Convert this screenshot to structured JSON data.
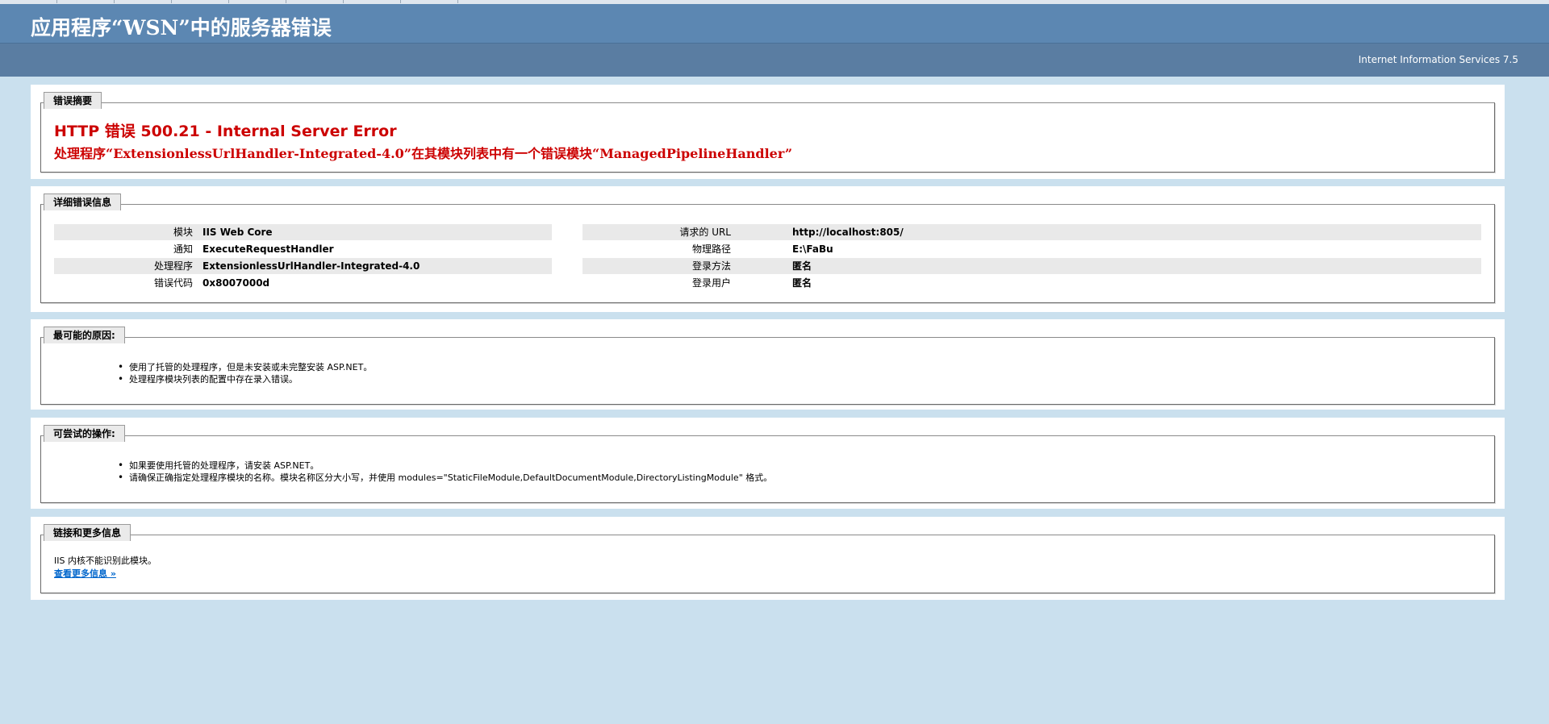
{
  "page": {
    "title": "应用程序“WSN”中的服务器错误",
    "server": "Internet Information Services 7.5"
  },
  "summary": {
    "legend": "错误摘要",
    "heading": "HTTP 错误 500.21 - Internal Server Error",
    "description": "处理程序“ExtensionlessUrlHandler-Integrated-4.0”在其模块列表中有一个错误模块“ManagedPipelineHandler”"
  },
  "details": {
    "legend": "详细错误信息",
    "left": [
      {
        "label": "模块",
        "value": "IIS Web Core"
      },
      {
        "label": "通知",
        "value": "ExecuteRequestHandler"
      },
      {
        "label": "处理程序",
        "value": "ExtensionlessUrlHandler-Integrated-4.0"
      },
      {
        "label": "错误代码",
        "value": "0x8007000d"
      }
    ],
    "right": [
      {
        "label": "请求的 URL",
        "value": "http://localhost:805/"
      },
      {
        "label": "物理路径",
        "value": "E:\\FaBu"
      },
      {
        "label": "登录方法",
        "value": "匿名"
      },
      {
        "label": "登录用户",
        "value": "匿名"
      }
    ]
  },
  "causes": {
    "legend": "最可能的原因:",
    "items": [
      "使用了托管的处理程序，但是未安装或未完整安装 ASP.NET。",
      "处理程序模块列表的配置中存在录入错误。"
    ]
  },
  "actions": {
    "legend": "可尝试的操作:",
    "items": [
      "如果要使用托管的处理程序，请安装 ASP.NET。",
      "请确保正确指定处理程序模块的名称。模块名称区分大小写，并使用 modules=\"StaticFileModule,DefaultDocumentModule,DirectoryListingModule\" 格式。"
    ]
  },
  "links": {
    "legend": "链接和更多信息",
    "text": "IIS 内核不能识别此模块。",
    "more": "查看更多信息 »"
  },
  "colors": {
    "background": "#cae0ee",
    "header": "#5c87b2",
    "subheader": "#5a7da2",
    "error_red": "#cc0000",
    "link": "#0066cc"
  }
}
